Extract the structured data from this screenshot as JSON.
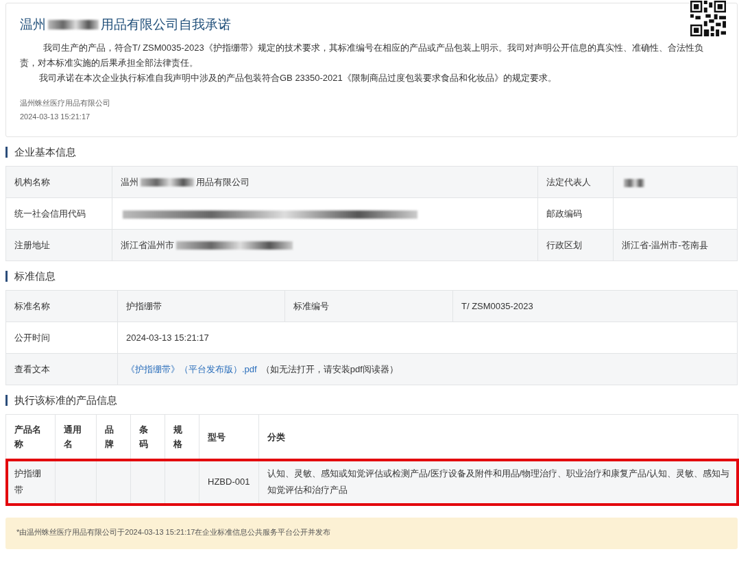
{
  "commitment": {
    "title": [
      {
        "kind": "text",
        "text": "温州"
      },
      {
        "kind": "redacted"
      },
      {
        "kind": "text",
        "text": "用品有限公司自我承诺"
      }
    ],
    "paragraphs": [
      "我司生产的产品，符合T/ ZSM0035-2023《护指绷带》规定的技术要求，其标准编号在相应的产品或产品包装上明示。我司对声明公开信息的真实性、准确性、合法性负责，对本标准实施的后果承担全部法律责任。",
      "我司承诺在本次企业执行标准自我声明中涉及的产品包装符合GB 23350-2021《限制商品过度包装要求食品和化妆品》的规定要求。"
    ],
    "company": "温州蛛丝医疗用品有限公司",
    "date": "2024-03-13 15:21:17"
  },
  "basic_info": {
    "heading": "企业基本信息",
    "rows": [
      {
        "label": "机构名称",
        "value": [
          {
            "kind": "text",
            "text": "温州"
          },
          {
            "kind": "redacted"
          },
          {
            "kind": "text",
            "text": "用品有限公司"
          }
        ],
        "label2": "法定代表人",
        "value2": [
          {
            "kind": "redacted"
          }
        ]
      },
      {
        "label": "统一社会信用代码",
        "value": [
          {
            "kind": "redacted"
          }
        ],
        "label2": "邮政编码",
        "value2": []
      },
      {
        "label": "注册地址",
        "value": [
          {
            "kind": "text",
            "text": "浙江省温州市"
          },
          {
            "kind": "redacted"
          }
        ],
        "label2": "行政区划",
        "value2": [
          {
            "kind": "text",
            "text": "浙江省-温州市-苍南县"
          }
        ]
      }
    ]
  },
  "standard_info": {
    "heading": "标准信息",
    "name_label": "标准名称",
    "name": "护指绷带",
    "number_label": "标准编号",
    "number": "T/ ZSM0035-2023",
    "time_label": "公开时间",
    "time": "2024-03-13 15:21:17",
    "text_label": "查看文本",
    "link": "《护指绷带》（平台发布版）.pdf",
    "link_note": "（如无法打开，请安装pdf阅读器）"
  },
  "products": {
    "heading": "执行该标准的产品信息",
    "columns": [
      "产品名称",
      "通用名",
      "品牌",
      "条码",
      "规格",
      "型号",
      "分类"
    ],
    "rows": [
      {
        "highlighted": true,
        "cells": [
          "护指绷带",
          "",
          "",
          "",
          "",
          "HZBD-001",
          "认知、灵敏、感知或知觉评估或检测产品/医疗设备及附件和用品/物理治疗、职业治疗和康复产品/认知、灵敏、感知与知觉评估和治疗产品"
        ]
      }
    ]
  },
  "footer": "*由温州蛛丝医疗用品有限公司于2024-03-13 15:21:17在企业标准信息公共服务平台公开并发布"
}
